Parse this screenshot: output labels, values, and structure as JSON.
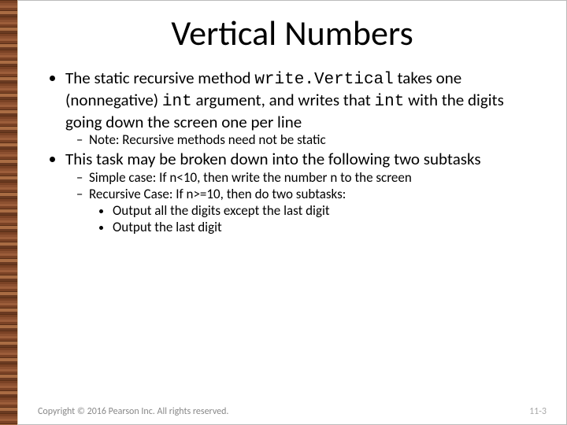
{
  "title": "Vertical Numbers",
  "b1": {
    "a": "The static recursive method ",
    "code1": "write.Vertical",
    "b": " takes one (nonnegative) ",
    "code2": "int",
    "c": " argument, and writes that ",
    "code3": "int",
    "d": " with the digits going down the screen one per line",
    "note": "Note:  Recursive methods need not be static"
  },
  "b2": {
    "text": "This task may be broken down into the following two subtasks",
    "simple": "Simple case:  If n<10, then write the number n to the screen",
    "recursive": "Recursive Case:  If n>=10, then do two subtasks:",
    "sub1": "Output all the digits except the last digit",
    "sub2": "Output the last digit"
  },
  "footer": {
    "copyright": "Copyright © 2016 Pearson Inc. All rights reserved.",
    "page": "11-3"
  }
}
